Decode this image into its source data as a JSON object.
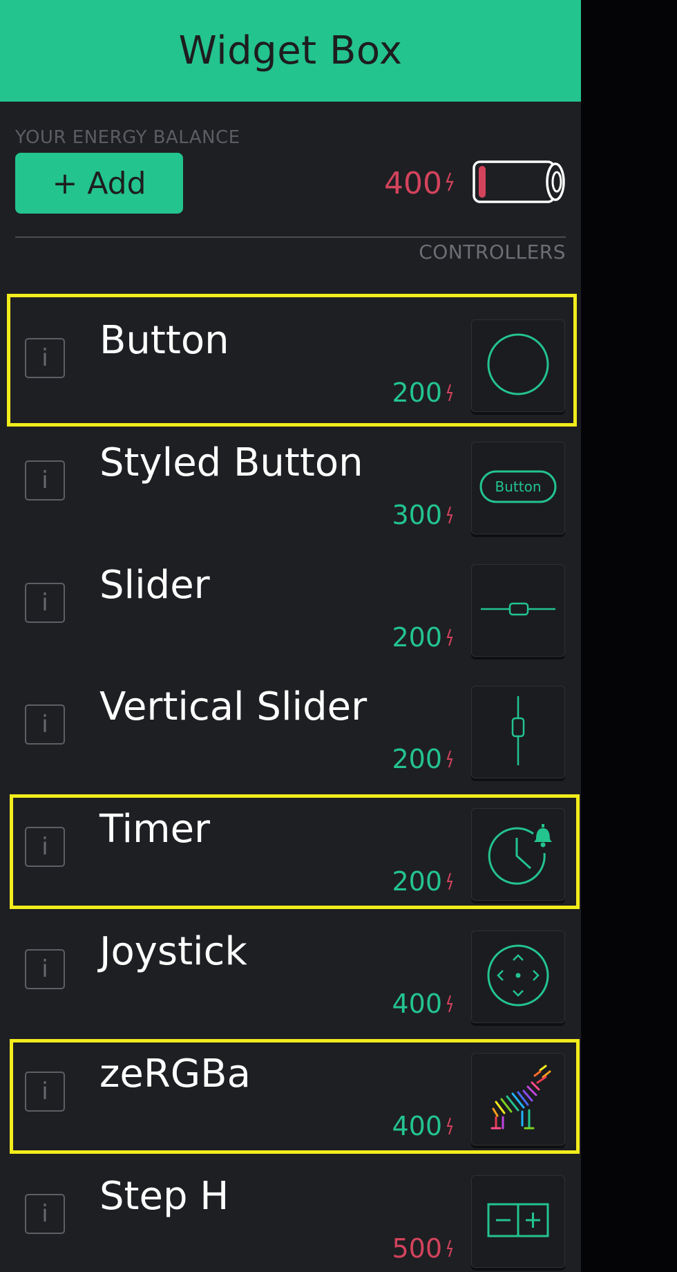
{
  "header": {
    "title": "Widget Box"
  },
  "energy": {
    "label": "YOUR ENERGY BALANCE",
    "add_label": "+ Add",
    "balance": "400",
    "battery_level": 0.1
  },
  "section": {
    "label": "CONTROLLERS"
  },
  "widgets": [
    {
      "name": "Button",
      "cost": "200",
      "icon": "button-circle-icon",
      "highlighted": true
    },
    {
      "name": "Styled Button",
      "cost": "300",
      "icon": "styled-button-icon",
      "icon_text": "Button"
    },
    {
      "name": "Slider",
      "cost": "200",
      "icon": "horizontal-slider-icon"
    },
    {
      "name": "Vertical Slider",
      "cost": "200",
      "icon": "vertical-slider-icon"
    },
    {
      "name": "Timer",
      "cost": "200",
      "icon": "timer-icon",
      "highlighted": true
    },
    {
      "name": "Joystick",
      "cost": "400",
      "icon": "joystick-icon"
    },
    {
      "name": "zeRGBa",
      "cost": "400",
      "icon": "zebra-icon",
      "highlighted": true
    },
    {
      "name": "Step H",
      "cost": "500",
      "cost_color": "red",
      "icon": "step-h-icon"
    }
  ],
  "info_glyph": "i",
  "colors": {
    "accent": "#23c48e",
    "alert": "#d3435c",
    "highlight": "#f2ec1c",
    "background": "#1e1f23"
  }
}
